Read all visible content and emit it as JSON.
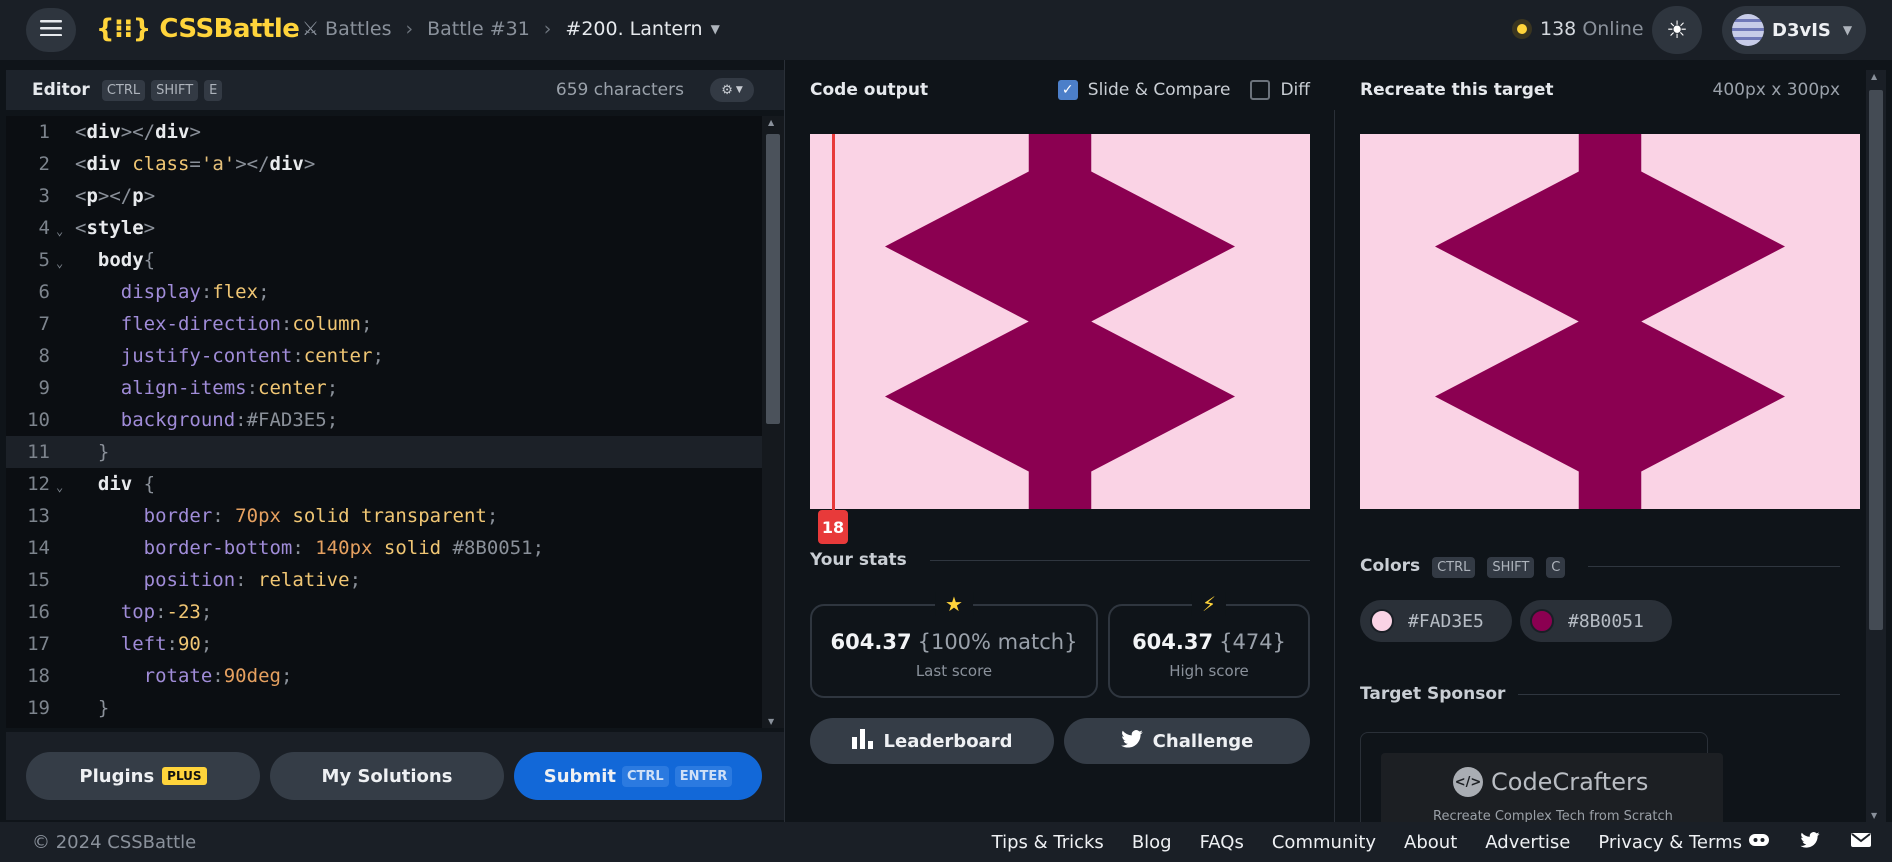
{
  "header": {
    "logo": "{⁝⁝} CSSBattle",
    "breadcrumb": [
      "Battles",
      "Battle #31",
      "#200. Lantern"
    ],
    "online_count": "138",
    "online_label": "Online",
    "username": "D3vIS"
  },
  "editor": {
    "title": "Editor",
    "shortcut": [
      "CTRL",
      "SHIFT",
      "E"
    ],
    "char_count": "659 characters",
    "lines": [
      {
        "n": "1",
        "parts": [
          [
            "tg",
            "<"
          ],
          [
            "tn",
            "div"
          ],
          [
            "tg",
            "></"
          ],
          [
            "tn",
            "div"
          ],
          [
            "tg",
            ">"
          ]
        ]
      },
      {
        "n": "2",
        "parts": [
          [
            "tg",
            "<"
          ],
          [
            "tn",
            "div "
          ],
          [
            "at",
            "class"
          ],
          [
            "tg",
            "="
          ],
          [
            "sv",
            "'a'"
          ],
          [
            "tg",
            "></"
          ],
          [
            "tn",
            "div"
          ],
          [
            "tg",
            ">"
          ]
        ]
      },
      {
        "n": "3",
        "parts": [
          [
            "tg",
            "<"
          ],
          [
            "tn",
            "p"
          ],
          [
            "tg",
            "></"
          ],
          [
            "tn",
            "p"
          ],
          [
            "tg",
            ">"
          ]
        ]
      },
      {
        "n": "4",
        "fold": true,
        "parts": [
          [
            "tg",
            "<"
          ],
          [
            "tn",
            "style"
          ],
          [
            "tg",
            ">"
          ]
        ]
      },
      {
        "n": "5",
        "fold": true,
        "parts": [
          [
            "tn",
            "  body"
          ],
          [
            "tg",
            "{"
          ]
        ]
      },
      {
        "n": "6",
        "parts": [
          [
            "pr",
            "    display"
          ],
          [
            "tg",
            ":"
          ],
          [
            "vl",
            "flex"
          ],
          [
            "pc",
            ";"
          ]
        ]
      },
      {
        "n": "7",
        "parts": [
          [
            "pr",
            "    flex-direction"
          ],
          [
            "tg",
            ":"
          ],
          [
            "vl",
            "column"
          ],
          [
            "pc",
            ";"
          ]
        ]
      },
      {
        "n": "8",
        "parts": [
          [
            "pr",
            "    justify-content"
          ],
          [
            "tg",
            ":"
          ],
          [
            "vl",
            "center"
          ],
          [
            "pc",
            ";"
          ]
        ]
      },
      {
        "n": "9",
        "parts": [
          [
            "pr",
            "    align-items"
          ],
          [
            "tg",
            ":"
          ],
          [
            "vl",
            "center"
          ],
          [
            "pc",
            ";"
          ]
        ]
      },
      {
        "n": "10",
        "parts": [
          [
            "pr",
            "    background"
          ],
          [
            "tg",
            ":"
          ],
          [
            "tg",
            "#FAD3E5"
          ],
          [
            "pc",
            ";"
          ]
        ]
      },
      {
        "n": "11",
        "active": true,
        "parts": [
          [
            "tg",
            "  }"
          ]
        ]
      },
      {
        "n": "12",
        "fold": true,
        "parts": [
          [
            "tn",
            "  div "
          ],
          [
            "tg",
            "{"
          ]
        ]
      },
      {
        "n": "13",
        "parts": [
          [
            "pr",
            "      border"
          ],
          [
            "tg",
            ": "
          ],
          [
            "nm",
            "70"
          ],
          [
            "nm",
            "px"
          ],
          [
            "vl",
            " solid transparent"
          ],
          [
            "pc",
            ";"
          ]
        ]
      },
      {
        "n": "14",
        "parts": [
          [
            "pr",
            "      border-bottom"
          ],
          [
            "tg",
            ": "
          ],
          [
            "nm",
            "140"
          ],
          [
            "nm",
            "px"
          ],
          [
            "vl",
            " solid "
          ],
          [
            "tg",
            "#8B0051"
          ],
          [
            "pc",
            ";"
          ]
        ]
      },
      {
        "n": "15",
        "parts": [
          [
            "pr",
            "      position"
          ],
          [
            "tg",
            ": "
          ],
          [
            "vl",
            "relative"
          ],
          [
            "pc",
            ";"
          ]
        ]
      },
      {
        "n": "16",
        "parts": [
          [
            "pr",
            "    top"
          ],
          [
            "tg",
            ":"
          ],
          [
            "vl",
            "-23"
          ],
          [
            "pc",
            ";"
          ]
        ]
      },
      {
        "n": "17",
        "parts": [
          [
            "pr",
            "    left"
          ],
          [
            "tg",
            ":"
          ],
          [
            "vl",
            "90"
          ],
          [
            "pc",
            ";"
          ]
        ]
      },
      {
        "n": "18",
        "parts": [
          [
            "pr",
            "      rotate"
          ],
          [
            "tg",
            ":"
          ],
          [
            "nm",
            "90"
          ],
          [
            "nm",
            "deg"
          ],
          [
            "pc",
            ";"
          ]
        ]
      },
      {
        "n": "19",
        "parts": [
          [
            "tg",
            "  }"
          ]
        ]
      }
    ],
    "buttons": {
      "plugins": "Plugins",
      "plugins_badge": "PLUS",
      "solutions": "My Solutions",
      "submit": "Submit",
      "submit_keys": [
        "CTRL",
        "ENTER"
      ]
    }
  },
  "output": {
    "title": "Code output",
    "slide_label": "Slide & Compare",
    "slide_checked": true,
    "diff_label": "Diff",
    "diff_checked": false,
    "slider_value": "18",
    "stats_title": "Your stats",
    "last_score": "604.37",
    "last_match": "{100% match}",
    "last_label": "Last score",
    "high_score": "604.37",
    "high_chars": "{474}",
    "high_label": "High score",
    "leaderboard": "Leaderboard",
    "challenge": "Challenge"
  },
  "target": {
    "title": "Recreate this target",
    "size": "400px x 300px",
    "colors_title": "Colors",
    "colors_keys": [
      "CTRL",
      "SHIFT",
      "C"
    ],
    "colors": [
      "#FAD3E5",
      "#8B0051"
    ],
    "sponsor_title": "Target Sponsor",
    "sponsor_name": "CodeCrafters",
    "sponsor_tagline": "Recreate Complex Tech from Scratch"
  },
  "footer": {
    "copyright": "© 2024 CSSBattle",
    "links": [
      "Tips & Tricks",
      "Blog",
      "FAQs",
      "Community",
      "About",
      "Advertise",
      "Privacy & Terms"
    ]
  },
  "theme": {
    "accent": "#ffd43b",
    "bg": "#fad3e5",
    "fg": "#8b0051",
    "submit": "#1268d8"
  }
}
